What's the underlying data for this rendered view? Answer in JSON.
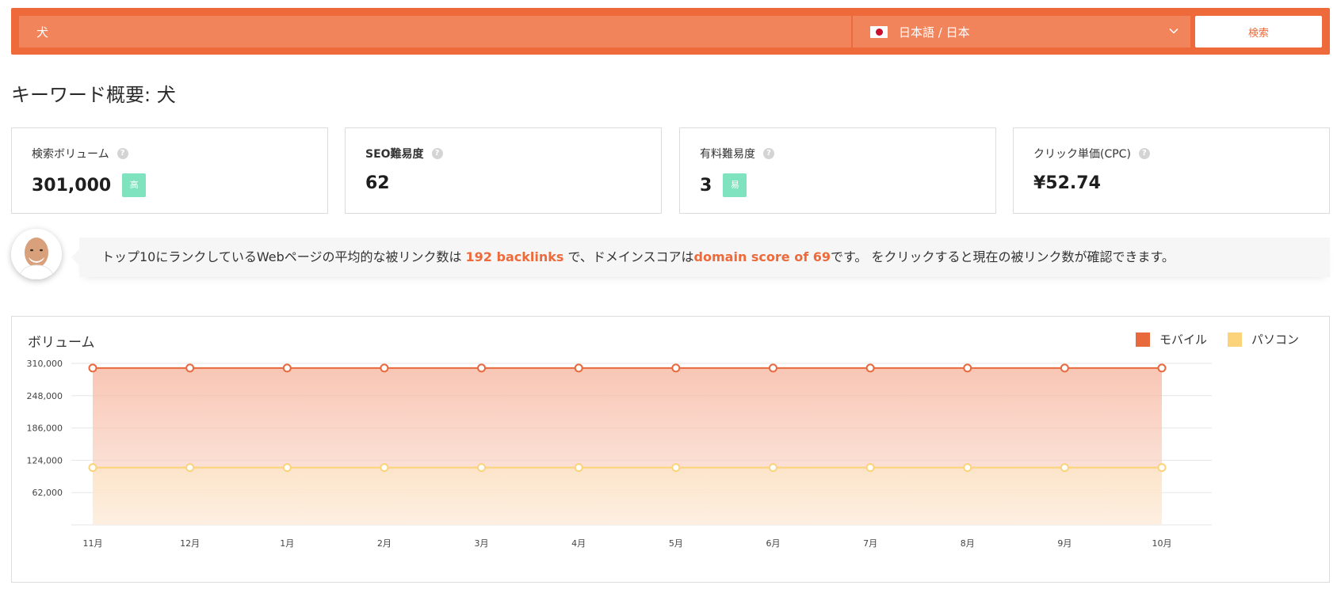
{
  "search": {
    "query": "犬",
    "language_label": "日本語 / 日本",
    "button_label": "検索"
  },
  "page_title": "キーワード概要: 犬",
  "cards": [
    {
      "label": "検索ボリューム",
      "value": "301,000",
      "badge": "高"
    },
    {
      "label": "SEO難易度",
      "value": "62",
      "badge": ""
    },
    {
      "label": "有料難易度",
      "value": "3",
      "badge": "易"
    },
    {
      "label": "クリック単価(CPC)",
      "value": "¥52.74",
      "badge": ""
    }
  ],
  "tip": {
    "text_1": "トップ10にランクしているWebページの平均的な被リンク数は ",
    "backlinks": "192 backlinks",
    "text_2": " で、ドメインスコアは",
    "domain_score": "domain score of 69",
    "text_3": "です。 をクリックすると現在の被リンク数が確認できます。"
  },
  "colors": {
    "accent": "#ee6a3a",
    "mobile": "#e8693c",
    "desktop": "#fcd27a",
    "badge": "#7fe3bf"
  },
  "chart_data": {
    "type": "area",
    "title": "ボリューム",
    "categories": [
      "11月",
      "12月",
      "1月",
      "2月",
      "3月",
      "4月",
      "5月",
      "6月",
      "7月",
      "8月",
      "9月",
      "10月"
    ],
    "series": [
      {
        "name": "モバイル",
        "values": [
          301000,
          301000,
          301000,
          301000,
          301000,
          301000,
          301000,
          301000,
          301000,
          301000,
          301000,
          301000
        ]
      },
      {
        "name": "パソコン",
        "values": [
          110000,
          110000,
          110000,
          110000,
          110000,
          110000,
          110000,
          110000,
          110000,
          110000,
          110000,
          110000
        ]
      }
    ],
    "yticks": [
      "62,000",
      "124,000",
      "186,000",
      "248,000",
      "310,000"
    ],
    "ylim": [
      0,
      310000
    ],
    "grid": true,
    "legend": "top-right"
  }
}
